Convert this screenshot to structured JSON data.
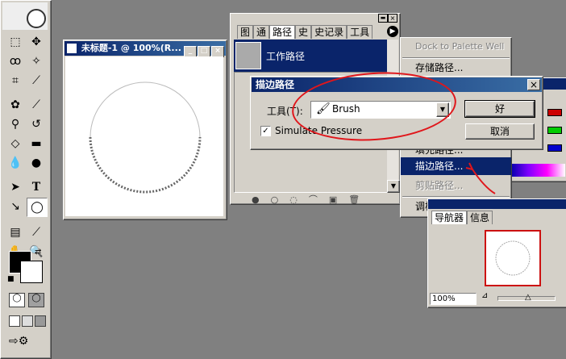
{
  "document": {
    "title": "未标题-1 @ 100%(R..."
  },
  "paths_panel": {
    "tabs": [
      "图",
      "通",
      "路径",
      "史",
      "史记录",
      "工具"
    ],
    "active_tab_index": 2,
    "work_path_label": "工作路径"
  },
  "context_menu": {
    "items": [
      "Dock to Palette Well",
      "存储路径...",
      "填充路径...",
      "描边路径...",
      "剪贴路径...",
      "调板选项..."
    ],
    "highlighted_index": 3
  },
  "dialog": {
    "title": "描边路径",
    "tool_label": "工具(T):",
    "tool_value": "Brush",
    "checkbox_label": "Simulate Pressure",
    "checkbox_checked": true,
    "ok_label": "好",
    "cancel_label": "取消"
  },
  "navigator": {
    "tabs": [
      "导航器",
      "信息"
    ],
    "zoom": "100%"
  },
  "colors": {
    "titlebar": "#0a246a",
    "annotation": "#e0161b",
    "panel": "#d4d0c8"
  }
}
